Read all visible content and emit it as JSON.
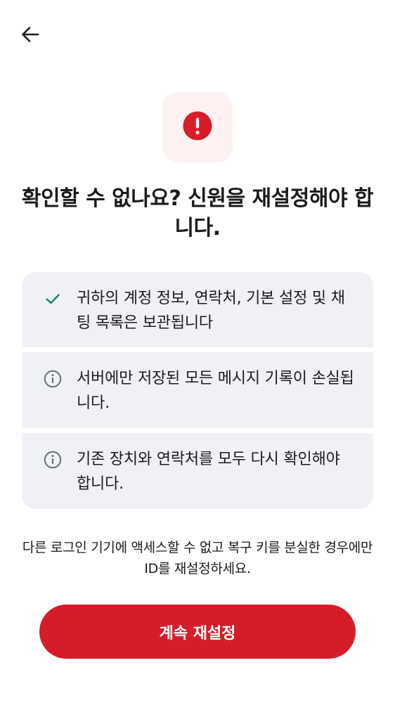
{
  "header": {
    "back_icon": "arrow-left-icon"
  },
  "hero": {
    "icon": "alert-circle-icon",
    "accent_color": "#d71c29",
    "icon_bg_color": "#fdf2f1"
  },
  "title": "확인할 수 없나요? 신원을 재설정해야 합니다.",
  "info_items": [
    {
      "icon": "check-icon",
      "icon_color": "#0f8a5f",
      "text": "귀하의 계정 정보, 연락처, 기본 설정 및 채팅 목록은 보관됩니다"
    },
    {
      "icon": "info-circle-icon",
      "icon_color": "#656d77",
      "text": "서버에만 저장된 모든 메시지 기록이 손실됩니다."
    },
    {
      "icon": "info-circle-icon",
      "icon_color": "#656d77",
      "text": "기존 장치와 연락처를 모두 다시 확인해야 합니다."
    }
  ],
  "footnote": "다른 로그인 기기에 액세스할 수 없고 복구 키를 분실한 경우에만 ID를 재설정하세요.",
  "primary_button": {
    "label": "계속 재설정",
    "color": "#d71c29"
  }
}
